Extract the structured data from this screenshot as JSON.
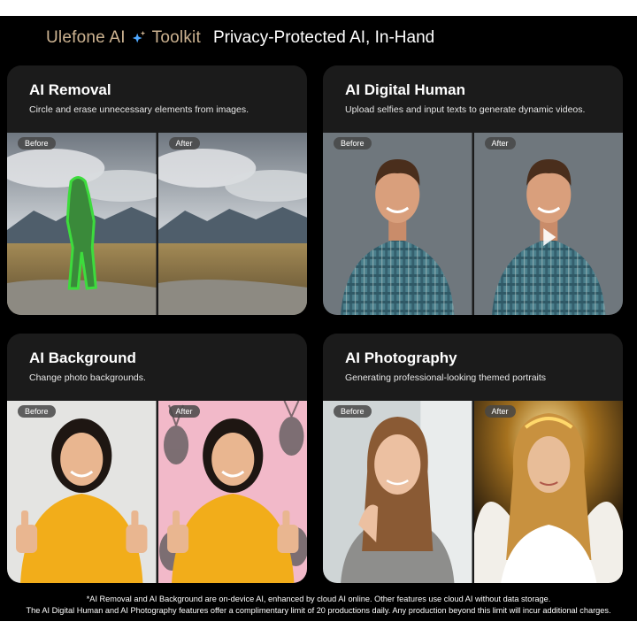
{
  "header": {
    "brand": "Ulefone AI",
    "brand_suffix": "Toolkit",
    "tagline": "Privacy-Protected AI, In-Hand"
  },
  "cards": [
    {
      "title": "AI Removal",
      "description": "Circle and erase unnecessary elements from images.",
      "before_label": "Before",
      "after_label": "After"
    },
    {
      "title": "AI Digital Human",
      "description": "Upload selfies and input texts to generate dynamic videos.",
      "before_label": "Before",
      "after_label": "After"
    },
    {
      "title": "AI Background",
      "description": "Change photo backgrounds.",
      "before_label": "Before",
      "after_label": "After"
    },
    {
      "title": "AI Photography",
      "description": "Generating professional-looking themed portraits",
      "before_label": "Before",
      "after_label": "After"
    }
  ],
  "footnotes": {
    "line1": "*AI Removal and AI Background are on-device AI, enhanced by cloud AI online. Other features use cloud AI without data storage.",
    "line2": "The AI Digital Human and AI Photography features offer a complimentary limit of 20 productions daily. Any production beyond this limit will incur additional charges."
  },
  "icons": {
    "brand_icon": "sparkle-icon",
    "play_icon": "play-icon"
  },
  "colors": {
    "brand": "#cdb391",
    "card_bg": "#1b1b1b",
    "selection_outline": "#3ddc3d"
  }
}
